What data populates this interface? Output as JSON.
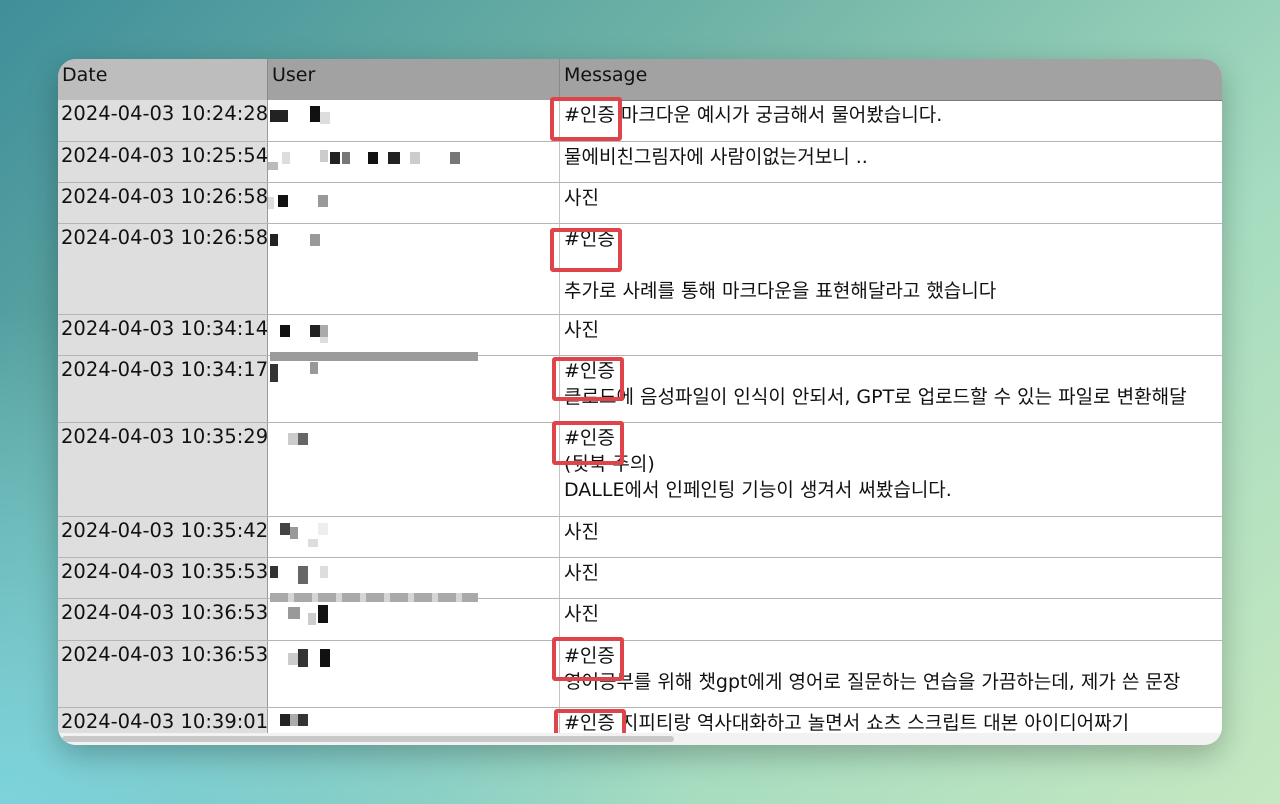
{
  "table": {
    "columns": {
      "date": "Date",
      "user": "User",
      "message": "Message"
    },
    "rows": [
      {
        "date": "2024-04-03 10:24:28",
        "lines": [
          "#인증 마크다운 예시가 궁금해서 물어봤습니다."
        ]
      },
      {
        "date": "2024-04-03 10:25:54",
        "lines": [
          "물에비친그림자에 사람이없는거보니 .."
        ]
      },
      {
        "date": "2024-04-03 10:26:58",
        "lines": [
          "사진"
        ]
      },
      {
        "date": "2024-04-03 10:26:58",
        "lines": [
          "#인증",
          "",
          "추가로 사례를 통해 마크다운을 표현해달라고 했습니다"
        ]
      },
      {
        "date": "2024-04-03 10:34:14",
        "lines": [
          "사진"
        ]
      },
      {
        "date": "2024-04-03 10:34:17",
        "lines": [
          "#인증",
          "클로드에 음성파일이 인식이 안되서, GPT로 업로드할 수 있는 파일로 변환해달"
        ]
      },
      {
        "date": "2024-04-03 10:35:29",
        "lines": [
          "#인증",
          "(뒷북 주의)",
          "DALLE에서 인페인팅 기능이 생겨서 써봤습니다."
        ]
      },
      {
        "date": "2024-04-03 10:35:42",
        "lines": [
          "사진"
        ]
      },
      {
        "date": "2024-04-03 10:35:53",
        "lines": [
          "사진"
        ]
      },
      {
        "date": "2024-04-03 10:36:53",
        "lines": [
          "사진"
        ]
      },
      {
        "date": "2024-04-03 10:36:53",
        "lines": [
          "#인증",
          "영어공부를 위해 챗gpt에게 영어로 질문하는 연습을 가끔하는데, 제가 쓴 문장"
        ]
      },
      {
        "date": "2024-04-03 10:39:01",
        "lines": [
          "#인증 지피티랑 역사대화하고 놀면서 쇼츠 스크립트 대본 아이디어짜기"
        ]
      }
    ]
  },
  "colors": {
    "highlight": "#e0444b",
    "header": "#a2a2a2",
    "date_column": "#dedede"
  }
}
